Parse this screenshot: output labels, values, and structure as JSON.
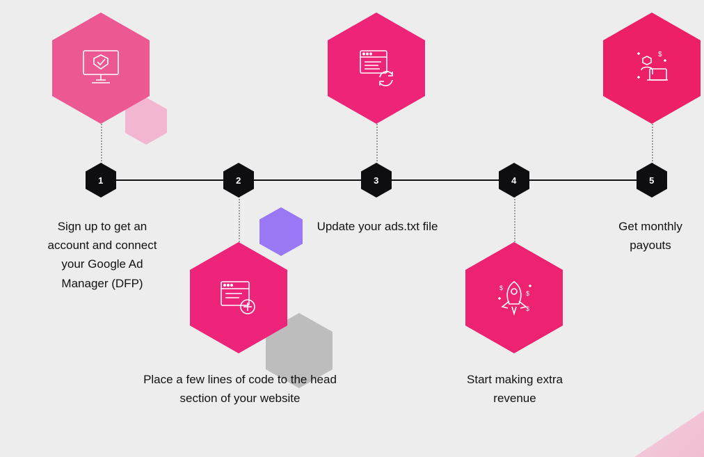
{
  "colors": {
    "hex1": "#ec5891",
    "hex2": "#ed247a",
    "hex3": "#ed2477",
    "hex4": "#ed2270",
    "hex5": "#ed1f66",
    "black": "#0e0e10",
    "deco_light_pink": "#f2b6d1",
    "deco_purple": "#9a77f5",
    "deco_gray": "#bdbdbd"
  },
  "steps": [
    {
      "num": "1",
      "label": "Sign up to get an account and connect your Google Ad Manager (DFP)"
    },
    {
      "num": "2",
      "label": "Place a few lines of code to the head section of your website"
    },
    {
      "num": "3",
      "label": "Update your ads.txt file"
    },
    {
      "num": "4",
      "label": "Start making extra revenue"
    },
    {
      "num": "5",
      "label": "Get monthly payouts"
    }
  ]
}
